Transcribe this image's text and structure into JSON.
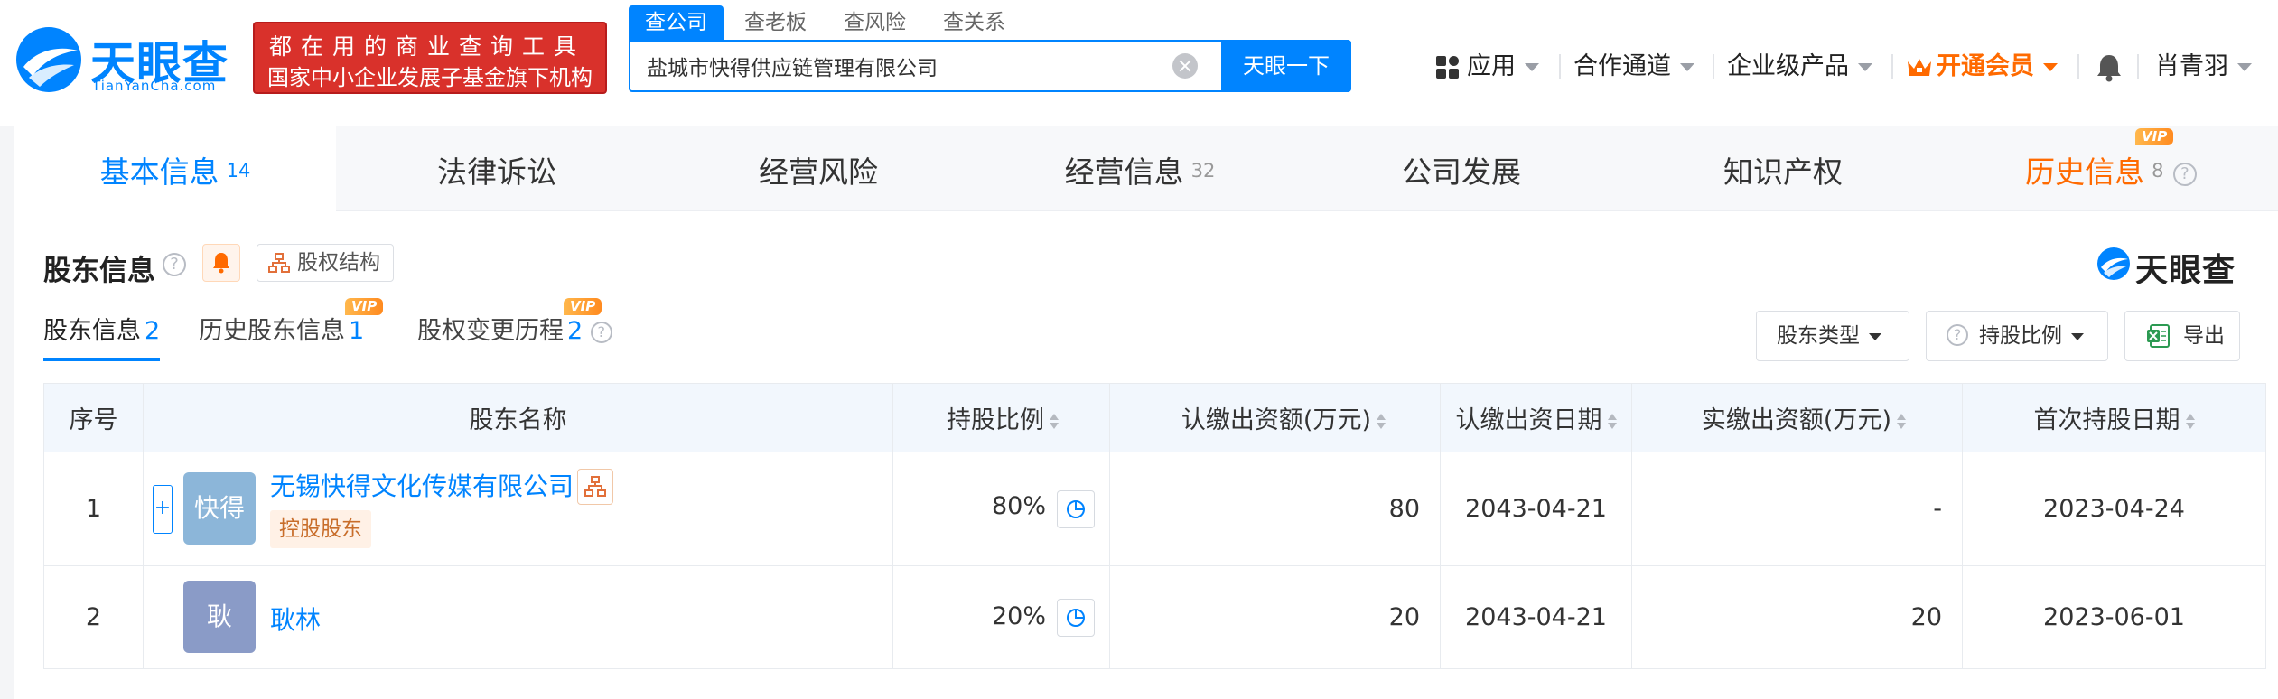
{
  "header": {
    "logo_cn": "天眼查",
    "logo_en": "TianYanCha.com",
    "ad_line1": "都在用的商业查询工具",
    "ad_line2": "国家中小企业发展子基金旗下机构",
    "search_tabs": [
      "查公司",
      "查老板",
      "查风险",
      "查关系"
    ],
    "search_value": "盐城市快得供应链管理有限公司",
    "search_button": "天眼一下",
    "nav": {
      "apps": "应用",
      "partner": "合作通道",
      "enterprise": "企业级产品",
      "vip": "开通会员",
      "user": "肖青羽"
    }
  },
  "main_tabs": [
    {
      "label": "基本信息",
      "count": "14"
    },
    {
      "label": "法律诉讼",
      "count": ""
    },
    {
      "label": "经营风险",
      "count": ""
    },
    {
      "label": "经营信息",
      "count": "32"
    },
    {
      "label": "公司发展",
      "count": ""
    },
    {
      "label": "知识产权",
      "count": ""
    },
    {
      "label": "历史信息",
      "count": "8",
      "badge": "VIP"
    }
  ],
  "section": {
    "title": "股东信息",
    "help": "?",
    "equity_button": "股权结构",
    "brand": "天眼查",
    "sub_tabs": [
      {
        "label": "股东信息",
        "count": "2"
      },
      {
        "label": "历史股东信息",
        "count": "1",
        "badge": "VIP"
      },
      {
        "label": "股权变更历程",
        "count": "2",
        "badge": "VIP"
      }
    ],
    "filters": {
      "type": "股东类型",
      "ratio": "持股比例",
      "export": "导出"
    }
  },
  "table": {
    "columns": [
      "序号",
      "股东名称",
      "持股比例",
      "认缴出资额(万元)",
      "认缴出资日期",
      "实缴出资额(万元)",
      "首次持股日期"
    ],
    "rows": [
      {
        "index": "1",
        "avatar": "快得",
        "name": "无锡快得文化传媒有限公司",
        "tag": "控股股东",
        "ratio": "80%",
        "subscribed": "80",
        "sub_date": "2043-04-21",
        "paid": "-",
        "first_date": "2023-04-24"
      },
      {
        "index": "2",
        "avatar": "耿",
        "name": "耿林",
        "tag": "",
        "ratio": "20%",
        "subscribed": "20",
        "sub_date": "2043-04-21",
        "paid": "20",
        "first_date": "2023-06-01"
      }
    ],
    "expand_symbol": "+"
  },
  "colors": {
    "brand_blue": "#0084ff",
    "vip_orange": "#ff6a00",
    "avatar_company": "#8cb6d9",
    "avatar_person": "#8a9bc7"
  }
}
